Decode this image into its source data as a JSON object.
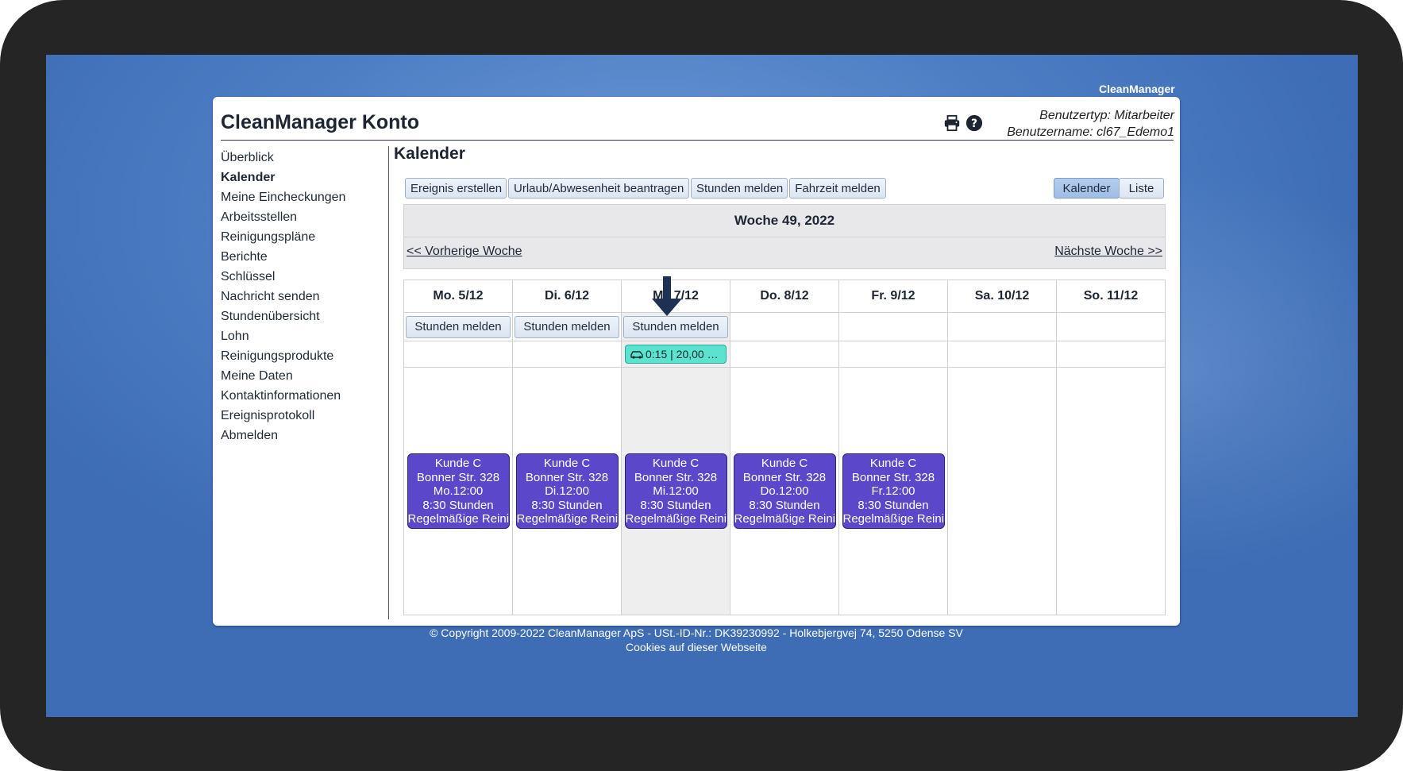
{
  "app_brand": "CleanManager",
  "header": {
    "title": "CleanManager Konto",
    "user_type": "Benutzertyp: Mitarbeiter",
    "username": "Benutzername: cl67_Edemo1",
    "icons": [
      "print-icon",
      "help-icon"
    ]
  },
  "sidebar": {
    "items": [
      {
        "label": "Überblick",
        "active": false
      },
      {
        "label": "Kalender",
        "active": true
      },
      {
        "label": "Meine Eincheckungen",
        "active": false
      },
      {
        "label": "Arbeitsstellen",
        "active": false
      },
      {
        "label": "Reinigungspläne",
        "active": false
      },
      {
        "label": "Berichte",
        "active": false
      },
      {
        "label": "Schlüssel",
        "active": false
      },
      {
        "label": "Nachricht senden",
        "active": false
      },
      {
        "label": "Stundenübersicht",
        "active": false
      },
      {
        "label": "Lohn",
        "active": false
      },
      {
        "label": "Reinigungsprodukte",
        "active": false
      },
      {
        "label": "Meine Daten",
        "active": false
      },
      {
        "label": "Kontaktinformationen",
        "active": false
      },
      {
        "label": "Ereignisprotokoll",
        "active": false
      },
      {
        "label": "Abmelden",
        "active": false
      }
    ]
  },
  "main": {
    "title": "Kalender",
    "actions": [
      "Ereignis erstellen",
      "Urlaub/Abwesenheit beantragen",
      "Stunden melden",
      "Fahrzeit melden"
    ],
    "view_toggle": {
      "calendar": "Kalender",
      "list": "Liste",
      "selected": "Kalender"
    },
    "week_title": "Woche 49, 2022",
    "prev_week": "<< Vorherige Woche",
    "next_week": "Nächste Woche >>"
  },
  "calendar": {
    "days": [
      "Mo. 5/12",
      "Di. 6/12",
      "Mi. 7/12",
      "Do. 8/12",
      "Fr. 9/12",
      "Sa. 10/12",
      "So. 11/12"
    ],
    "today_index": 2,
    "report_button_label": "Stunden melden",
    "report_buttons_on": [
      0,
      1,
      2
    ],
    "travel_badge": {
      "day_index": 2,
      "text": "0:15 | 20,00 …",
      "icon": "car-icon"
    },
    "events": [
      {
        "day_index": 0,
        "customer": "Kunde C",
        "address": "Bonner Str. 328",
        "time": "Mo.12:00",
        "duration": "8:30 Stunden",
        "type": "Regelmäßige Reinigung"
      },
      {
        "day_index": 1,
        "customer": "Kunde C",
        "address": "Bonner Str. 328",
        "time": "Di.12:00",
        "duration": "8:30 Stunden",
        "type": "Regelmäßige Reinigung"
      },
      {
        "day_index": 2,
        "customer": "Kunde C",
        "address": "Bonner Str. 328",
        "time": "Mi.12:00",
        "duration": "8:30 Stunden",
        "type": "Regelmäßige Reinigung"
      },
      {
        "day_index": 3,
        "customer": "Kunde C",
        "address": "Bonner Str. 328",
        "time": "Do.12:00",
        "duration": "8:30 Stunden",
        "type": "Regelmäßige Reinigung"
      },
      {
        "day_index": 4,
        "customer": "Kunde C",
        "address": "Bonner Str. 328",
        "time": "Fr.12:00",
        "duration": "8:30 Stunden",
        "type": "Regelmäßige Reinigung"
      }
    ]
  },
  "footer": {
    "copyright": "© Copyright 2009-2022 CleanManager ApS - USt.-ID-Nr.: DK39230992 - Holkebjergvej 74, 5250 Odense SV",
    "cookies": "Cookies auf dieser Webseite"
  },
  "colors": {
    "event_bg": "#5a47c9",
    "badge_bg": "#5be3cf",
    "desktop_bg": "#4d7ec4",
    "arrow": "#1f3152"
  }
}
